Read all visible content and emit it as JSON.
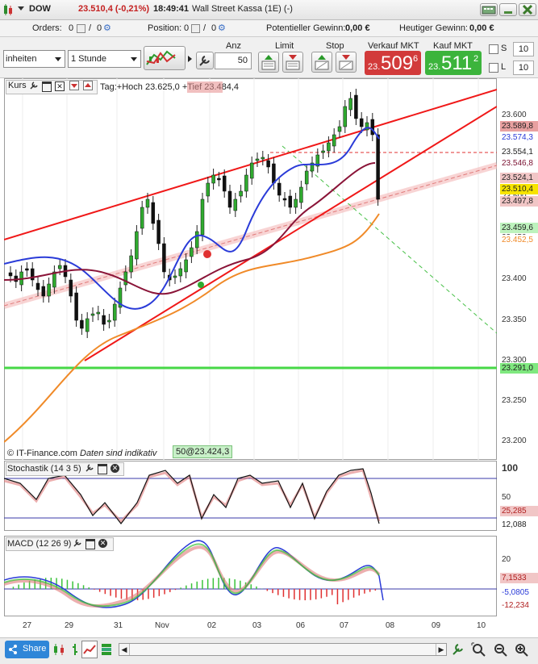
{
  "header": {
    "instrument": "DOW",
    "price_change": "23.510,4 (-0,21%)",
    "time": "18:49:41",
    "title": "Wall Street Kassa (1E) (-)"
  },
  "orderbar": {
    "orders_label": "Orders:",
    "orders_a": "0",
    "orders_b": "0",
    "position_label": "Position:",
    "position_a": "0",
    "position_b": "0",
    "pot_gain_label": "Potentieller Gewinn:",
    "pot_gain_value": "0,00 €",
    "today_gain_label": "Heutiger Gewinn:",
    "today_gain_value": "0,00 €"
  },
  "toolbar": {
    "unit_select": "inheiten",
    "interval_select": "1 Stunde",
    "anz_label": "Anz",
    "anz_value": "50",
    "limit_label": "Limit",
    "stop_label": "Stop",
    "sell_label": "Verkauf MKT",
    "buy_label": "Kauf MKT",
    "sell_prefix": "23.",
    "sell_big": "509",
    "sell_sup": "6",
    "buy_prefix": "23.",
    "buy_big": "511",
    "buy_sup": "2",
    "s_label": "S",
    "l_label": "L",
    "s_value": "10",
    "l_value": "10"
  },
  "chart_panel": {
    "title": "Kurs",
    "info": "Tag:+Hoch 23.625,0 +Tief 23.484,4",
    "brand": "© IT-Finance.com",
    "disclaimer": "Daten sind indikativ",
    "ma_label": "50@23.424,3"
  },
  "stoch_panel": {
    "title": "Stochastik (14 3 5)"
  },
  "macd_panel": {
    "title": "MACD (12 26 9)"
  },
  "price_axis": {
    "ticks": [
      "23.600",
      "23.550",
      "23.500",
      "23.450",
      "23.400",
      "23.350",
      "23.300",
      "23.250",
      "23.200"
    ],
    "tags": [
      {
        "text": "23.589,8",
        "bg": "#e8a0a0",
        "fg": "#222"
      },
      {
        "text": "23.574,3",
        "bg": "#ffffff",
        "fg": "#2a3bd8"
      },
      {
        "text": "23.554,1",
        "bg": "#ffffff",
        "fg": "#222"
      },
      {
        "text": "23.546,8",
        "bg": "#ffffff",
        "fg": "#7a1030"
      },
      {
        "text": "23.524,1",
        "bg": "#f1c6c6",
        "fg": "#222"
      },
      {
        "text": "23.510,4",
        "bg": "#f7e400",
        "fg": "#222"
      },
      {
        "text": "23.497,8",
        "bg": "#f1c6c6",
        "fg": "#222"
      },
      {
        "text": "23.459,6",
        "bg": "#bdf2bd",
        "fg": "#222"
      },
      {
        "text": "23.452,5",
        "bg": "#ffffff",
        "fg": "#f08a28"
      },
      {
        "text": "23.291,0",
        "bg": "#7fe87f",
        "fg": "#222"
      }
    ]
  },
  "stoch_axis": {
    "ticks": [
      "100",
      "50"
    ],
    "tags": [
      "25,285",
      "12,088"
    ]
  },
  "macd_axis": {
    "ticks": [
      "20"
    ],
    "tags": [
      "7,1533",
      "-5,0805",
      "-12,234"
    ]
  },
  "time_axis": [
    "27",
    "29",
    "31",
    "Nov",
    "02",
    "03",
    "06",
    "07",
    "08",
    "09",
    "10"
  ],
  "bottom": {
    "share_label": "Share"
  }
}
